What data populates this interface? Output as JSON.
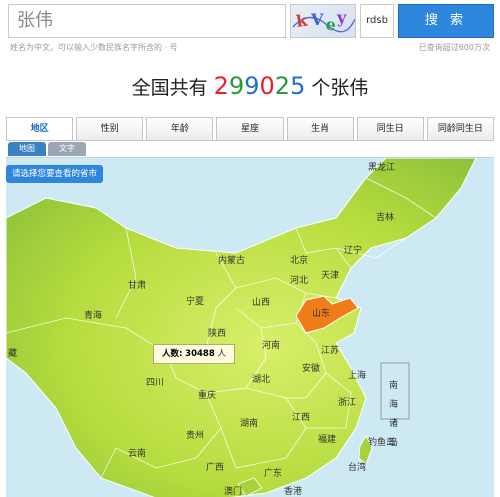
{
  "search": {
    "value": "张伟",
    "captcha_text": "rdsb",
    "button_label": "搜 索"
  },
  "hints": {
    "left": "姓名为中文，可以输入少数民族名字所含的 · 号",
    "right": "已查询超过600万次"
  },
  "headline": {
    "prefix": "全国共有",
    "count_digits": [
      "2",
      "9",
      "9",
      "0",
      "2",
      "5"
    ],
    "suffix": "个张伟"
  },
  "tabs": [
    "地区",
    "性别",
    "年龄",
    "星座",
    "生肖",
    "同生日",
    "同龄同生日"
  ],
  "subtabs": [
    "地图",
    "文字"
  ],
  "map": {
    "select_label": "请选择您要查看的省市",
    "tooltip": {
      "label": "人数:",
      "value": "30488",
      "unit": "人"
    },
    "provinces": {
      "heilongjiang": "黑龙江",
      "jilin": "吉林",
      "liaoning": "辽宁",
      "neimenggu": "内蒙古",
      "beijing": "北京",
      "tianjin": "天津",
      "hebei": "河北",
      "shanxi": "山西",
      "shandong": "山东",
      "gansu": "甘肃",
      "ningxia": "宁夏",
      "qinghai": "青海",
      "shaanxi": "陕西",
      "henan": "河南",
      "jiangsu": "江苏",
      "anhui": "安徽",
      "shanghai": "上海",
      "sichuan": "四川",
      "hubei": "湖北",
      "zhejiang": "浙江",
      "chongqing": "重庆",
      "hunan": "湖南",
      "jiangxi": "江西",
      "guizhou": "贵州",
      "fujian": "福建",
      "yunnan": "云南",
      "guangxi": "广西",
      "guangdong": "广东",
      "taiwan": "台湾",
      "xizang": "藏",
      "nanhai": "南海诸岛",
      "diaoyudao": "钓鱼岛",
      "aomen": "澳门",
      "xianggang": "香港"
    }
  },
  "colors": {
    "highlight": "#f07d1a",
    "primary": "#2f86dd",
    "land": "#a7d23a",
    "sea": "#cdeaf4"
  }
}
